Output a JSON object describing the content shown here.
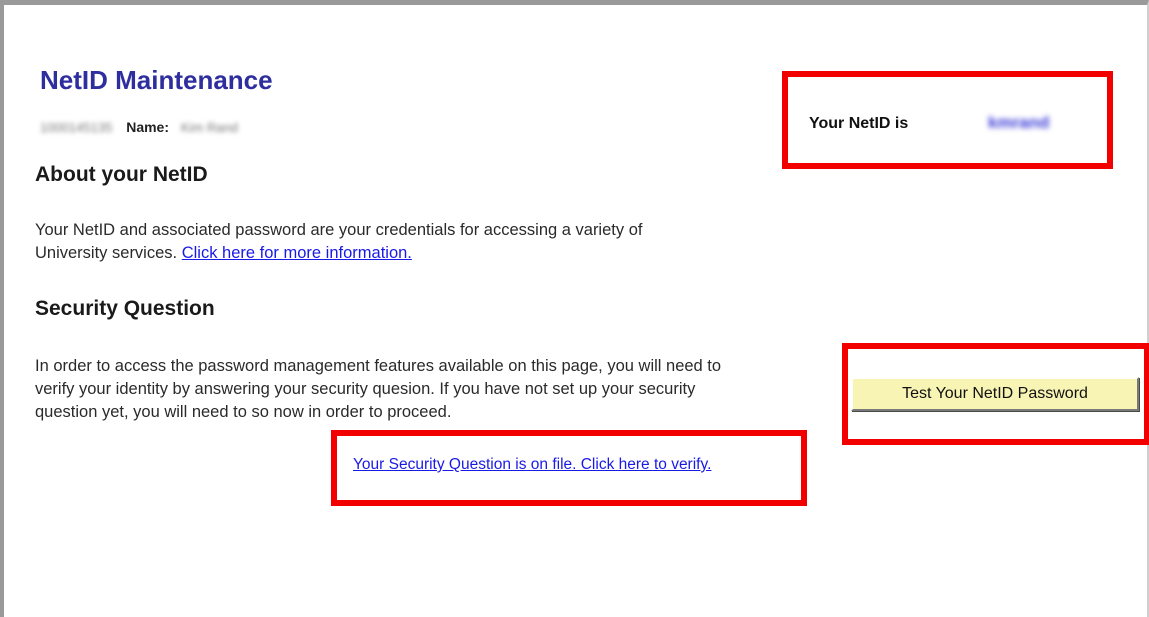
{
  "page": {
    "title": "NetID Maintenance",
    "student_id": "1000145135",
    "name_label": "Name:",
    "name_value": "Kim Rand"
  },
  "netid_box": {
    "label": "Your NetID is",
    "value": "kmrand"
  },
  "about": {
    "heading": "About your NetID",
    "text": "Your NetID and associated password are your credentials for accessing a variety of University services.",
    "link": "Click here for more information."
  },
  "security": {
    "heading": "Security Question",
    "text": "In order to access the password management features available on this page, you will need to verify your identity by answering your security quesion. If you have not set up your security question yet, you will need to so now in order to proceed.",
    "verify_link": "Your Security Question is on file. Click here to verify."
  },
  "actions": {
    "test_password_label": "Test Your NetID Password"
  },
  "colors": {
    "title": "#2e2e9e",
    "highlight_border": "#f20000",
    "link": "#1a1ae6",
    "button_bg": "#f8f4b4"
  }
}
